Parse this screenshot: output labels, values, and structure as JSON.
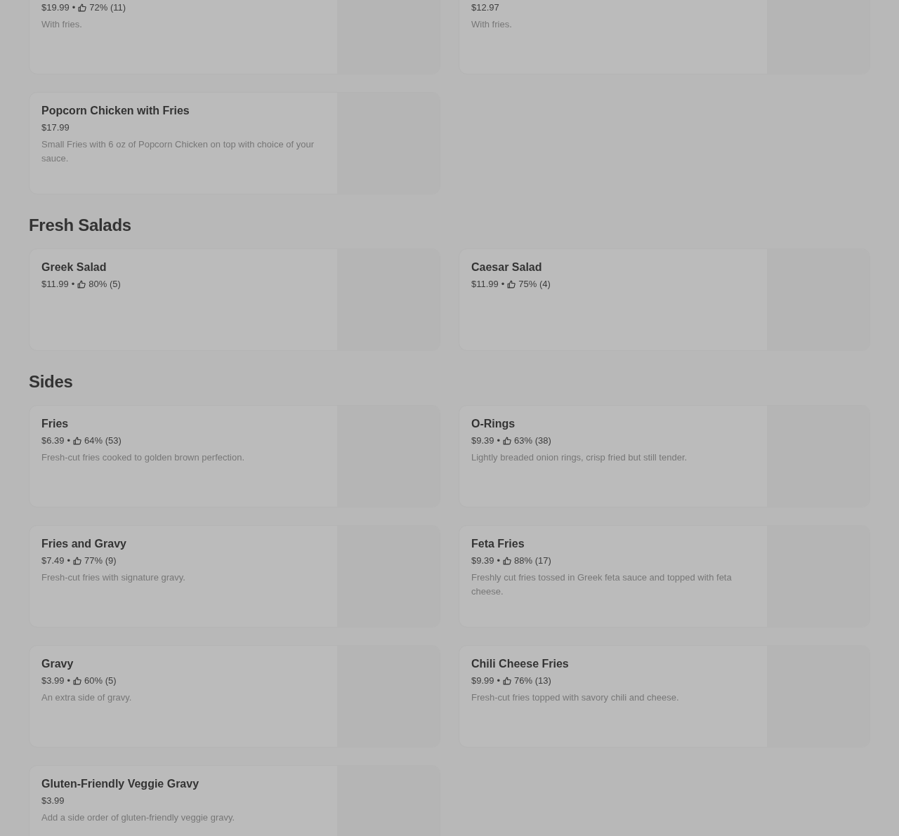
{
  "sections": [
    {
      "items": [
        {
          "price": "$19.99",
          "separator": "•",
          "rating": "72% (11)",
          "description": "With fries."
        },
        {
          "price": "$12.97",
          "description": "With fries."
        },
        {
          "name": "Popcorn Chicken with Fries",
          "price": "$17.99",
          "description": "Small Fries with 6 oz of Popcorn Chicken on top with choice of your sauce."
        }
      ]
    },
    {
      "heading": "Fresh Salads",
      "items": [
        {
          "name": "Greek Salad",
          "price": "$11.99",
          "separator": "•",
          "rating": "80% (5)"
        },
        {
          "name": "Caesar Salad",
          "price": "$11.99",
          "separator": "•",
          "rating": "75% (4)"
        }
      ]
    },
    {
      "heading": "Sides",
      "items": [
        {
          "name": "Fries",
          "price": "$6.39",
          "separator": "•",
          "rating": "64% (53)",
          "description": "Fresh-cut fries cooked to golden brown perfection."
        },
        {
          "name": "O-Rings",
          "price": "$9.39",
          "separator": "•",
          "rating": "63% (38)",
          "description": "Lightly breaded onion rings, crisp fried but still tender."
        },
        {
          "name": "Fries and Gravy",
          "price": "$7.49",
          "separator": "•",
          "rating": "77% (9)",
          "description": "Fresh-cut fries with signature gravy."
        },
        {
          "name": "Feta Fries",
          "price": "$9.39",
          "separator": "•",
          "rating": "88% (17)",
          "description": "Freshly cut fries tossed in Greek feta sauce and topped with feta cheese."
        },
        {
          "name": "Gravy",
          "price": "$3.99",
          "separator": "•",
          "rating": "60% (5)",
          "description": "An extra side of gravy."
        },
        {
          "name": "Chili Cheese Fries",
          "price": "$9.99",
          "separator": "•",
          "rating": "76% (13)",
          "description": "Fresh-cut fries topped with savory chili and cheese."
        },
        {
          "name": "Gluten-Friendly Veggie Gravy",
          "price": "$3.99",
          "description": "Add a side order of gluten-friendly veggie gravy."
        }
      ]
    }
  ]
}
